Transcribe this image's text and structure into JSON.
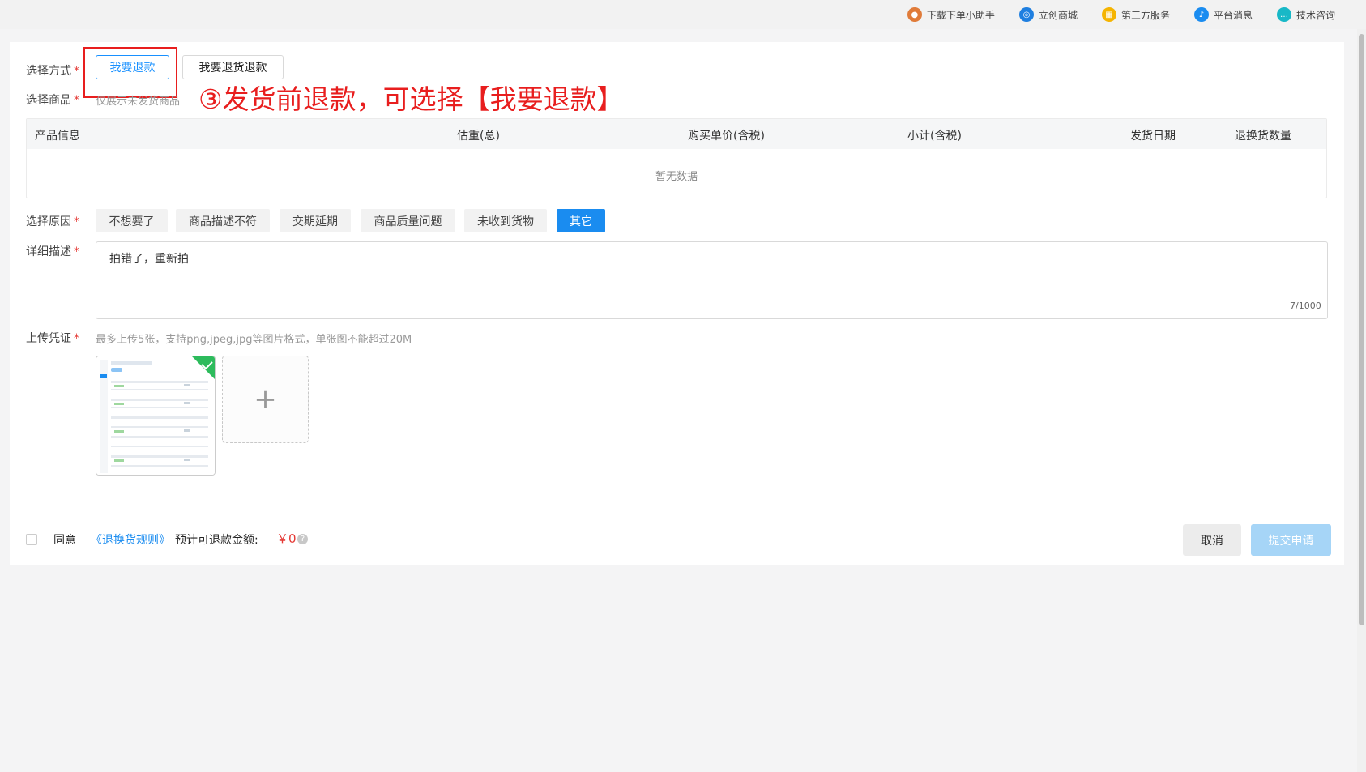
{
  "topbar": {
    "items": [
      {
        "label": "下载下单小助手",
        "icon": "avatar-icon",
        "color": "#e07b39"
      },
      {
        "label": "立创商城",
        "icon": "mall-icon",
        "color": "#1f7fe0"
      },
      {
        "label": "第三方服务",
        "icon": "grid-icon",
        "color": "#f5b400"
      },
      {
        "label": "平台消息",
        "icon": "bell-icon",
        "color": "#1a8cf0"
      },
      {
        "label": "技术咨询",
        "icon": "chat-icon",
        "color": "#18b8c7"
      }
    ]
  },
  "form": {
    "method_label": "选择方式",
    "method_options": [
      "我要退款",
      "我要退货退款"
    ],
    "goods_label": "选择商品",
    "goods_hint": "仅展示未发货商品",
    "reason_label": "选择原因",
    "reasons": [
      "不想要了",
      "商品描述不符",
      "交期延期",
      "商品质量问题",
      "未收到货物",
      "其它"
    ],
    "desc_label": "详细描述",
    "desc_value": "拍错了，重新拍",
    "desc_count": "7/1000",
    "upload_label": "上传凭证",
    "upload_hint": "最多上传5张，支持png,jpeg,jpg等图片格式，单张图不能超过20M",
    "required_mark": "*"
  },
  "annotation": {
    "text": "③发货前退款，可选择【我要退款】"
  },
  "table": {
    "columns": [
      "产品信息",
      "估重(总)",
      "购买单价(含税)",
      "小计(含税)",
      "发货日期",
      "退换货数量"
    ],
    "empty_text": "暂无数据"
  },
  "footer": {
    "agree": "同意",
    "rule_link": "《退换货规则》",
    "estimate_label": "预计可退款金额:",
    "amount": "￥0",
    "cancel": "取消",
    "submit": "提交申请"
  },
  "colors": {
    "primary": "#1a8cf0",
    "annotation_red": "#e81e1e",
    "required_red": "#e53935"
  }
}
